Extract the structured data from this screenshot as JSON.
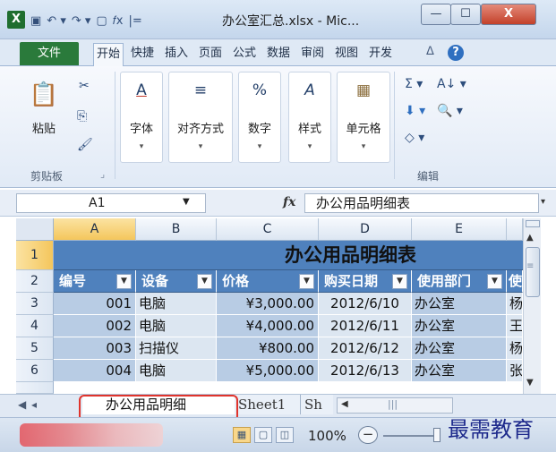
{
  "window": {
    "app_icon": "X",
    "title": "办公室汇总.xlsx - Mic...",
    "min": "—",
    "max": "☐",
    "close": "X"
  },
  "qat": {
    "save": "▣",
    "undo": "↶ ▾",
    "redo": "↷ ▾",
    "new": "▢",
    "fx": "𝑓x",
    "customize": "|="
  },
  "ribbon_tabs": {
    "file": "文件",
    "items": [
      "开始",
      "快捷",
      "插入",
      "页面",
      "公式",
      "数据",
      "审阅",
      "视图",
      "开发"
    ],
    "help": "?",
    "collapse": "ᐃ"
  },
  "ribbon": {
    "paste_label": "粘贴",
    "cut_icon": "✂",
    "copy_icon": "⎘",
    "format_painter_icon": "🖌",
    "clipboard_group": "剪贴板",
    "launcher": "⌟",
    "font_label": "字体",
    "align_label": "对齐方式",
    "number_label": "数字",
    "styles_label": "样式",
    "cells_label": "单元格",
    "editing_group": "编辑",
    "sum_icon": "Σ ▾",
    "sort_icon": "A↓ ▾",
    "fill_icon": "⬇ ▾",
    "find_icon": "🔍 ▾",
    "clear_icon": "◇ ▾",
    "font_glyph": "A",
    "align_glyph": "≡",
    "number_glyph": "%",
    "styles_glyph": "A",
    "cells_glyph": "▦",
    "caret": "▾"
  },
  "formula_bar": {
    "name_box": "A1",
    "fx": "fx",
    "formula": "办公用品明细表"
  },
  "grid": {
    "columns": [
      "A",
      "B",
      "C",
      "D",
      "E"
    ],
    "rows": [
      "1",
      "2",
      "3",
      "4",
      "5",
      "6"
    ],
    "title": "办公用品明细表",
    "headers": [
      "编号",
      "设备",
      "价格",
      "购买日期",
      "使用部门",
      "使"
    ],
    "data": [
      [
        "001",
        "电脑",
        "¥3,000.00",
        "2012/6/10",
        "办公室",
        "杨"
      ],
      [
        "002",
        "电脑",
        "¥4,000.00",
        "2012/6/11",
        "办公室",
        "王"
      ],
      [
        "003",
        "扫描仪",
        "¥800.00",
        "2012/6/12",
        "办公室",
        "杨"
      ],
      [
        "004",
        "电脑",
        "¥5,000.00",
        "2012/6/13",
        "办公室",
        "张"
      ]
    ]
  },
  "sheet_tabs": {
    "nav": "◀ ◂",
    "items": [
      "办公用品明细",
      "Sheet1",
      "Sh"
    ]
  },
  "status_bar": {
    "zoom": "100%",
    "zoom_out": "−"
  },
  "watermark": "最需教育"
}
